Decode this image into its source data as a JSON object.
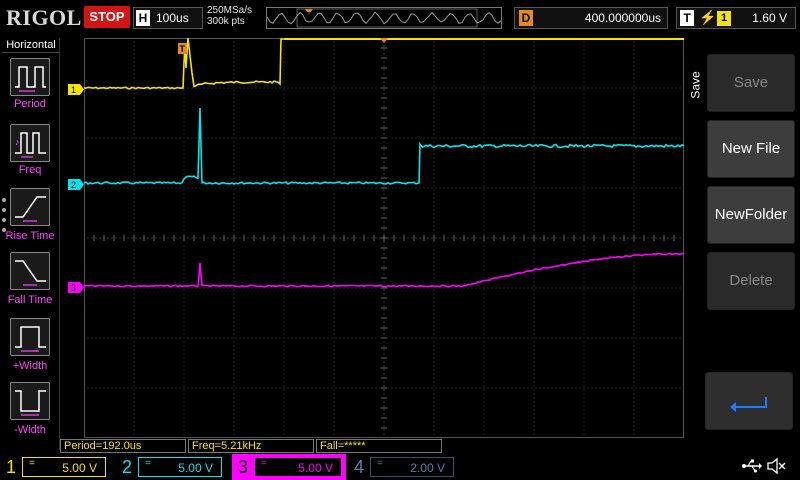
{
  "header": {
    "logo": "RIGOL",
    "run_state": "STOP",
    "timebase_badge": "H",
    "timebase": "100us",
    "sample_rate": "250MSa/s",
    "memory_depth": "300k pts",
    "trigger_marker": "T",
    "delay_badge": "D",
    "delay": "400.000000us",
    "trigger_badge": "T",
    "trigger_edge_icon": "rising-edge-icon",
    "trigger_source": "1",
    "trigger_level": "1.60 V"
  },
  "left_panel": {
    "title": "Horizontal",
    "items": [
      {
        "label": "Period",
        "icon": "period-icon"
      },
      {
        "label": "Freq",
        "icon": "frequency-icon"
      },
      {
        "label": "Rise Time",
        "icon": "rise-time-icon"
      },
      {
        "label": "Fall Time",
        "icon": "fall-time-icon"
      },
      {
        "label": "+Width",
        "icon": "positive-width-icon"
      },
      {
        "label": "-Width",
        "icon": "negative-width-icon"
      }
    ]
  },
  "right_menu": {
    "title": "Save",
    "buttons": [
      {
        "label": "Save",
        "enabled": false
      },
      {
        "label": "New File",
        "enabled": true
      },
      {
        "label": "NewFolder",
        "enabled": true
      },
      {
        "label": "Delete",
        "enabled": false
      }
    ],
    "back_icon": "return-arrow-icon"
  },
  "channel_markers": [
    {
      "label": "1",
      "color": "#f5e300"
    },
    {
      "label": "2",
      "color": "#00e5f0"
    },
    {
      "label": "3",
      "color": "#ff00ff"
    }
  ],
  "measurements": [
    {
      "text": "Period=192.0us"
    },
    {
      "text": "Freq=5.21kHz"
    },
    {
      "text": "Fall=*****"
    }
  ],
  "channels": [
    {
      "num": "1",
      "coupling": "=",
      "scale": "5.00 V",
      "color": "#f5e300",
      "active": true
    },
    {
      "num": "2",
      "coupling": "=",
      "scale": "5.00 V",
      "color": "#00e5f0",
      "active": true
    },
    {
      "num": "3",
      "coupling": "=",
      "scale": "5.00 V",
      "color": "#ff00ff",
      "active": true
    },
    {
      "num": "4",
      "coupling": "=",
      "scale": "2.00 V",
      "color": "#5a7ea8",
      "active": false
    }
  ],
  "status_icons": [
    "usb-icon",
    "speaker-muted-icon"
  ],
  "colors": {
    "ch1": "#f5e300",
    "ch2": "#00e5f0",
    "ch3": "#ff00ff",
    "ch4": "#5a7ea8",
    "trigger": "#e58a1f",
    "stop": "#d21414"
  }
}
